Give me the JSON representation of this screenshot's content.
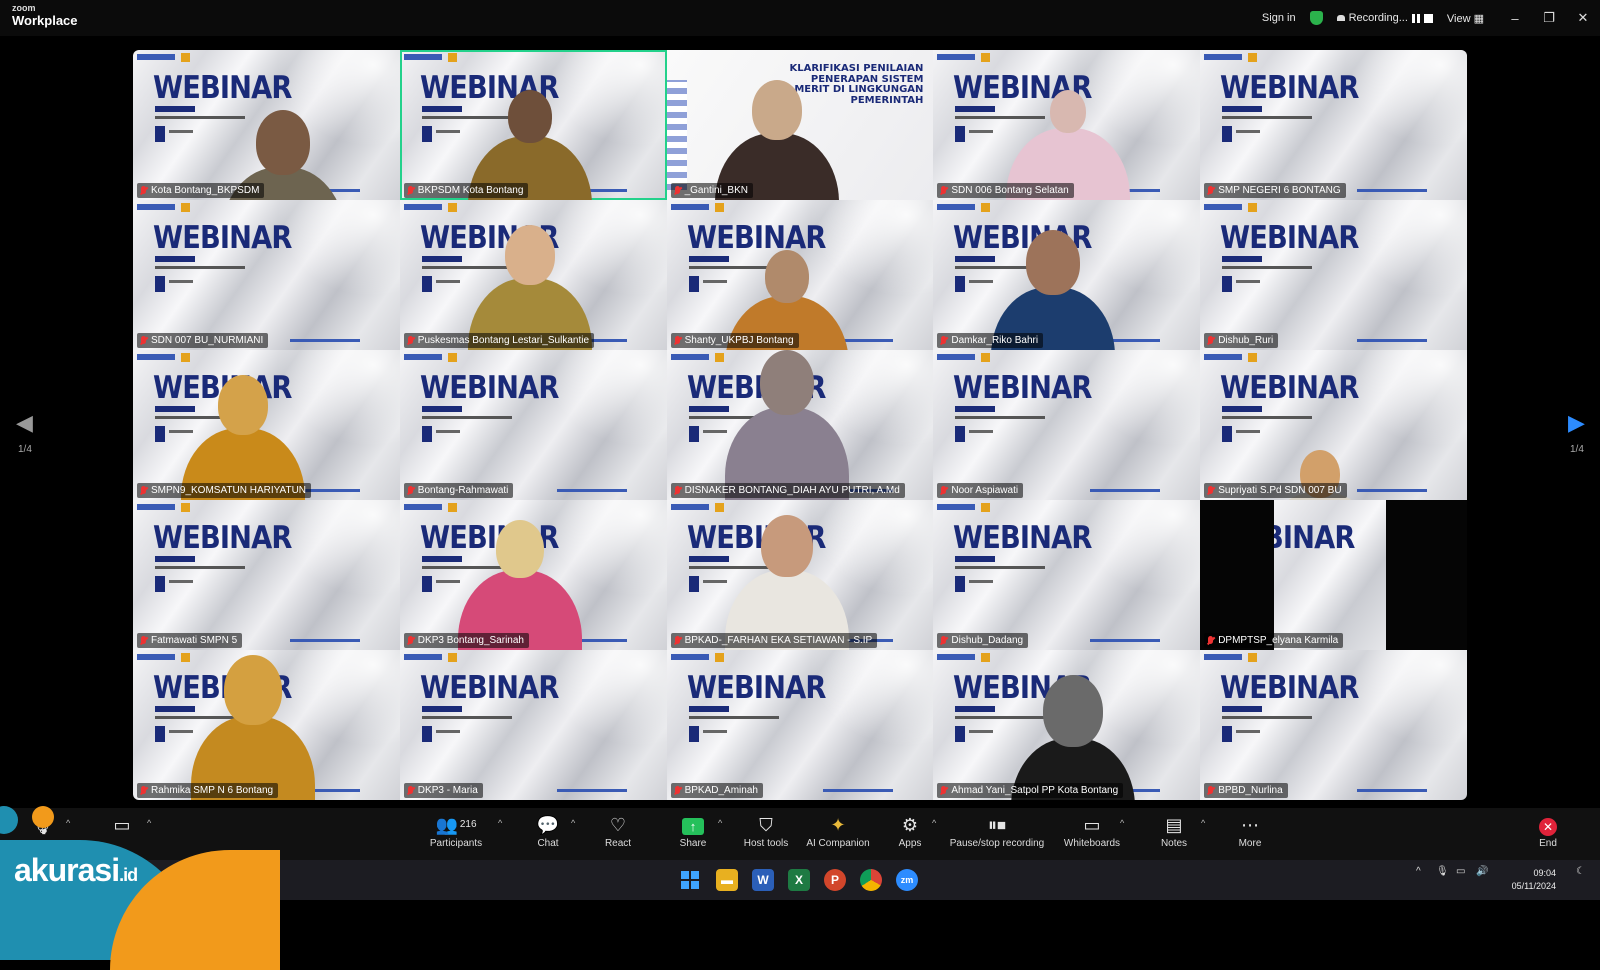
{
  "app": {
    "brand_top": "zoom",
    "brand_bottom": "Workplace"
  },
  "titlebar": {
    "sign_in": "Sign in",
    "recording": "Recording...",
    "view": "View",
    "minimize": "–",
    "restore": "❐",
    "close": "✕"
  },
  "nav": {
    "page_left": "1/4",
    "page_right": "1/4"
  },
  "tile_bg": {
    "webinar": "WEBINAR",
    "klarifikasi": "KLARIFIKASI PENILAIAN PENERAPAN SISTEM MERIT DI LINGKUNGAN PEMERINTAH"
  },
  "participants": [
    {
      "name": "Kota Bontang_BKPSDM"
    },
    {
      "name": "BKPSDM Kota Bontang"
    },
    {
      "name": "_Gantini_BKN"
    },
    {
      "name": "SDN 006 Bontang Selatan"
    },
    {
      "name": "SMP NEGERI 6 BONTANG"
    },
    {
      "name": "SDN 007 BU_NURMIANI"
    },
    {
      "name": "Puskesmas Bontang Lestari_Sulkantie"
    },
    {
      "name": "Shanty_UKPBJ Bontang"
    },
    {
      "name": "Damkar_Riko Bahri"
    },
    {
      "name": "Dishub_Ruri"
    },
    {
      "name": "SMPN9_KOMSATUN HARIYATUN"
    },
    {
      "name": "Bontang-Rahmawati"
    },
    {
      "name": "DISNAKER BONTANG_DIAH AYU PUTRI, A.Md"
    },
    {
      "name": "Noor Aspiawati"
    },
    {
      "name": "Supriyati S.Pd SDN 007 BU"
    },
    {
      "name": "Fatmawati SMPN 5"
    },
    {
      "name": "DKP3 Bontang_Sarinah"
    },
    {
      "name": "BPKAD-_FARHAN EKA SETIAWAN - S.IP"
    },
    {
      "name": "Dishub_Dadang"
    },
    {
      "name": "DPMPTSP_elyana Karmila"
    },
    {
      "name": "Rahmika SMP N 6 Bontang"
    },
    {
      "name": "DKP3 - Maria"
    },
    {
      "name": "BPKAD_Aminah"
    },
    {
      "name": "Ahmad Yani_Satpol PP Kota Bontang"
    },
    {
      "name": "BPBD_Nurlina"
    }
  ],
  "toolbar": {
    "participants_label": "Participants",
    "participants_count": "216",
    "chat": "Chat",
    "react": "React",
    "share": "Share",
    "host_tools": "Host tools",
    "ai_companion": "AI Companion",
    "apps": "Apps",
    "pause_stop": "Pause/stop recording",
    "whiteboards": "Whiteboards",
    "notes": "Notes",
    "more": "More",
    "end": "End"
  },
  "taskbar": {
    "time": "09:04",
    "date": "05/11/2024"
  },
  "watermark": {
    "text": "akurasi",
    "suffix": ".id"
  },
  "colors": {
    "active_speaker": "#23d18b",
    "share_green": "#25c05b",
    "end_red": "#e0233a",
    "brand_blue": "#1a2a78"
  }
}
